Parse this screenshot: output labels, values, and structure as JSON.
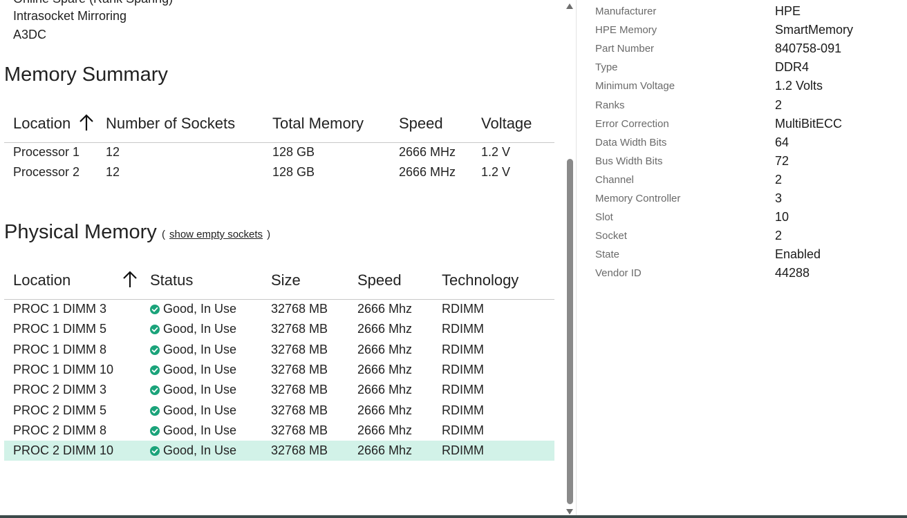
{
  "memory_mode": {
    "items": [
      "Online Spare (Rank Sparing)",
      "Intrasocket Mirroring",
      "A3DC"
    ]
  },
  "memory_summary": {
    "title": "Memory Summary",
    "columns": [
      "Location",
      "Number of Sockets",
      "Total Memory",
      "Speed",
      "Voltage"
    ],
    "rows": [
      {
        "location": "Processor 1",
        "sockets": "12",
        "total": "128 GB",
        "speed": "2666 MHz",
        "voltage": "1.2 V"
      },
      {
        "location": "Processor 2",
        "sockets": "12",
        "total": "128 GB",
        "speed": "2666 MHz",
        "voltage": "1.2 V"
      }
    ]
  },
  "physical_memory": {
    "title": "Physical Memory",
    "open_paren": "(",
    "show_empty_label": "show empty sockets",
    "close_paren": ")",
    "columns": [
      "Location",
      "Status",
      "Size",
      "Speed",
      "Technology"
    ],
    "status_color": "#1aa37a",
    "selected_color": "#d2f2e8",
    "rows": [
      {
        "location": "PROC 1 DIMM 3",
        "status": "Good, In Use",
        "size": "32768 MB",
        "speed": "2666 Mhz",
        "technology": "RDIMM"
      },
      {
        "location": "PROC 1 DIMM 5",
        "status": "Good, In Use",
        "size": "32768 MB",
        "speed": "2666 Mhz",
        "technology": "RDIMM"
      },
      {
        "location": "PROC 1 DIMM 8",
        "status": "Good, In Use",
        "size": "32768 MB",
        "speed": "2666 Mhz",
        "technology": "RDIMM"
      },
      {
        "location": "PROC 1 DIMM 10",
        "status": "Good, In Use",
        "size": "32768 MB",
        "speed": "2666 Mhz",
        "technology": "RDIMM"
      },
      {
        "location": "PROC 2 DIMM 3",
        "status": "Good, In Use",
        "size": "32768 MB",
        "speed": "2666 Mhz",
        "technology": "RDIMM"
      },
      {
        "location": "PROC 2 DIMM 5",
        "status": "Good, In Use",
        "size": "32768 MB",
        "speed": "2666 Mhz",
        "technology": "RDIMM"
      },
      {
        "location": "PROC 2 DIMM 8",
        "status": "Good, In Use",
        "size": "32768 MB",
        "speed": "2666 Mhz",
        "technology": "RDIMM"
      },
      {
        "location": "PROC 2 DIMM 10",
        "status": "Good, In Use",
        "size": "32768 MB",
        "speed": "2666 Mhz",
        "technology": "RDIMM",
        "selected": true
      }
    ]
  },
  "details": {
    "properties": [
      {
        "label": "Manufacturer",
        "value": "HPE"
      },
      {
        "label": "HPE Memory",
        "value": "SmartMemory"
      },
      {
        "label": "Part Number",
        "value": "840758-091"
      },
      {
        "label": "Type",
        "value": "DDR4"
      },
      {
        "label": "Minimum Voltage",
        "value": "1.2 Volts"
      },
      {
        "label": "Ranks",
        "value": "2"
      },
      {
        "label": "Error Correction",
        "value": "MultiBitECC"
      },
      {
        "label": "Data Width Bits",
        "value": "64"
      },
      {
        "label": "Bus Width Bits",
        "value": "72"
      },
      {
        "label": "Channel",
        "value": "2"
      },
      {
        "label": "Memory Controller",
        "value": "3"
      },
      {
        "label": "Slot",
        "value": "10"
      },
      {
        "label": "Socket",
        "value": "2"
      },
      {
        "label": "State",
        "value": "Enabled"
      },
      {
        "label": "Vendor ID",
        "value": "44288"
      }
    ]
  }
}
